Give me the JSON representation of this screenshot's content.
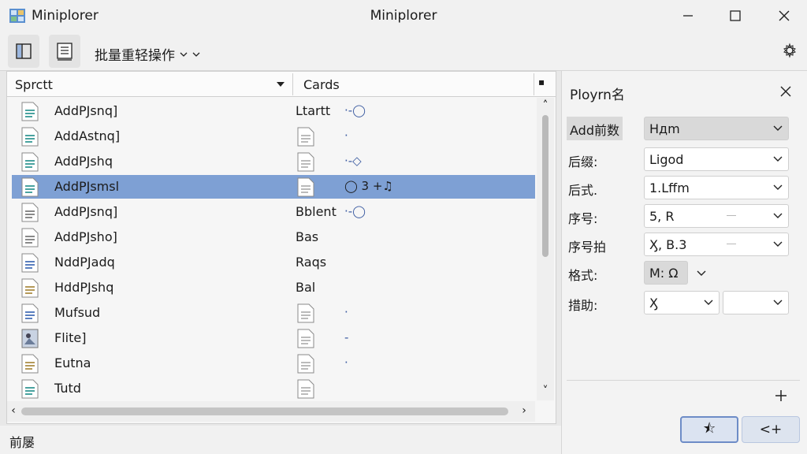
{
  "window": {
    "app_name": "Miniplorer",
    "title": "Miniplorer"
  },
  "toolbar": {
    "batch_label": "批量重轻操作"
  },
  "columns": {
    "name": "Sprctt",
    "cards": "Cards"
  },
  "files": [
    {
      "name": "AddPJsnq]",
      "card": "Ltartt",
      "extra": "·-◯",
      "icon": "doc-teal-icon",
      "type_icon": false,
      "selected": false
    },
    {
      "name": "AddAstnq]",
      "card": "",
      "extra": "·",
      "icon": "doc-teal-icon",
      "type_icon": true,
      "selected": false
    },
    {
      "name": "AddPJshq",
      "card": "",
      "extra": "·-◇",
      "icon": "doc-teal-icon",
      "type_icon": true,
      "selected": false
    },
    {
      "name": "AddPJsmsl",
      "card": "",
      "extra": "◯  3  +♫",
      "icon": "doc-teal-icon",
      "type_icon": true,
      "selected": true
    },
    {
      "name": "AddPJsnq]",
      "card": "Bblent",
      "extra": "·-◯",
      "icon": "doc-gray-icon",
      "type_icon": false,
      "selected": false
    },
    {
      "name": "AddPJsho]",
      "card": "Bas",
      "extra": "",
      "icon": "doc-gray-icon",
      "type_icon": false,
      "selected": false
    },
    {
      "name": "NddPJadq",
      "card": "Raqs",
      "extra": "",
      "icon": "doc-blue-icon",
      "type_icon": false,
      "selected": false
    },
    {
      "name": "HddPJshq",
      "card": "Bal",
      "extra": "",
      "icon": "doc-tan-icon",
      "type_icon": false,
      "selected": false
    },
    {
      "name": "Mufsud",
      "card": "",
      "extra": "·",
      "icon": "doc-blue-icon",
      "type_icon": true,
      "selected": false
    },
    {
      "name": "Flite]",
      "card": "",
      "extra": "-",
      "icon": "image-file-icon",
      "type_icon": true,
      "selected": false
    },
    {
      "name": "Eutna",
      "card": "",
      "extra": "·",
      "icon": "doc-tan-icon",
      "type_icon": true,
      "selected": false
    },
    {
      "name": "Tutd",
      "card": "",
      "extra": "",
      "icon": "doc-teal-icon",
      "type_icon": true,
      "selected": false
    }
  ],
  "status": {
    "text": "前屡"
  },
  "panel": {
    "title": "Ployrn名",
    "fields": [
      {
        "label": "Add前数",
        "value": "Hдm",
        "highlight": true,
        "dark": true
      },
      {
        "label": "后缀:",
        "value": "Ligod"
      },
      {
        "label": "后式.",
        "value": "1.Lffm"
      },
      {
        "label": "序号:",
        "value": "5, R"
      },
      {
        "label": "序号拍",
        "value": "Ӽ, B.3"
      },
      {
        "label": "格式:",
        "value": "M: Ω"
      },
      {
        "label": "措助:",
        "value": "Ӽ"
      }
    ],
    "apply_label": "⯪",
    "back_label": "<+"
  },
  "colors": {
    "selection": "#7ea0d4",
    "accent": "#6d8cc7"
  }
}
